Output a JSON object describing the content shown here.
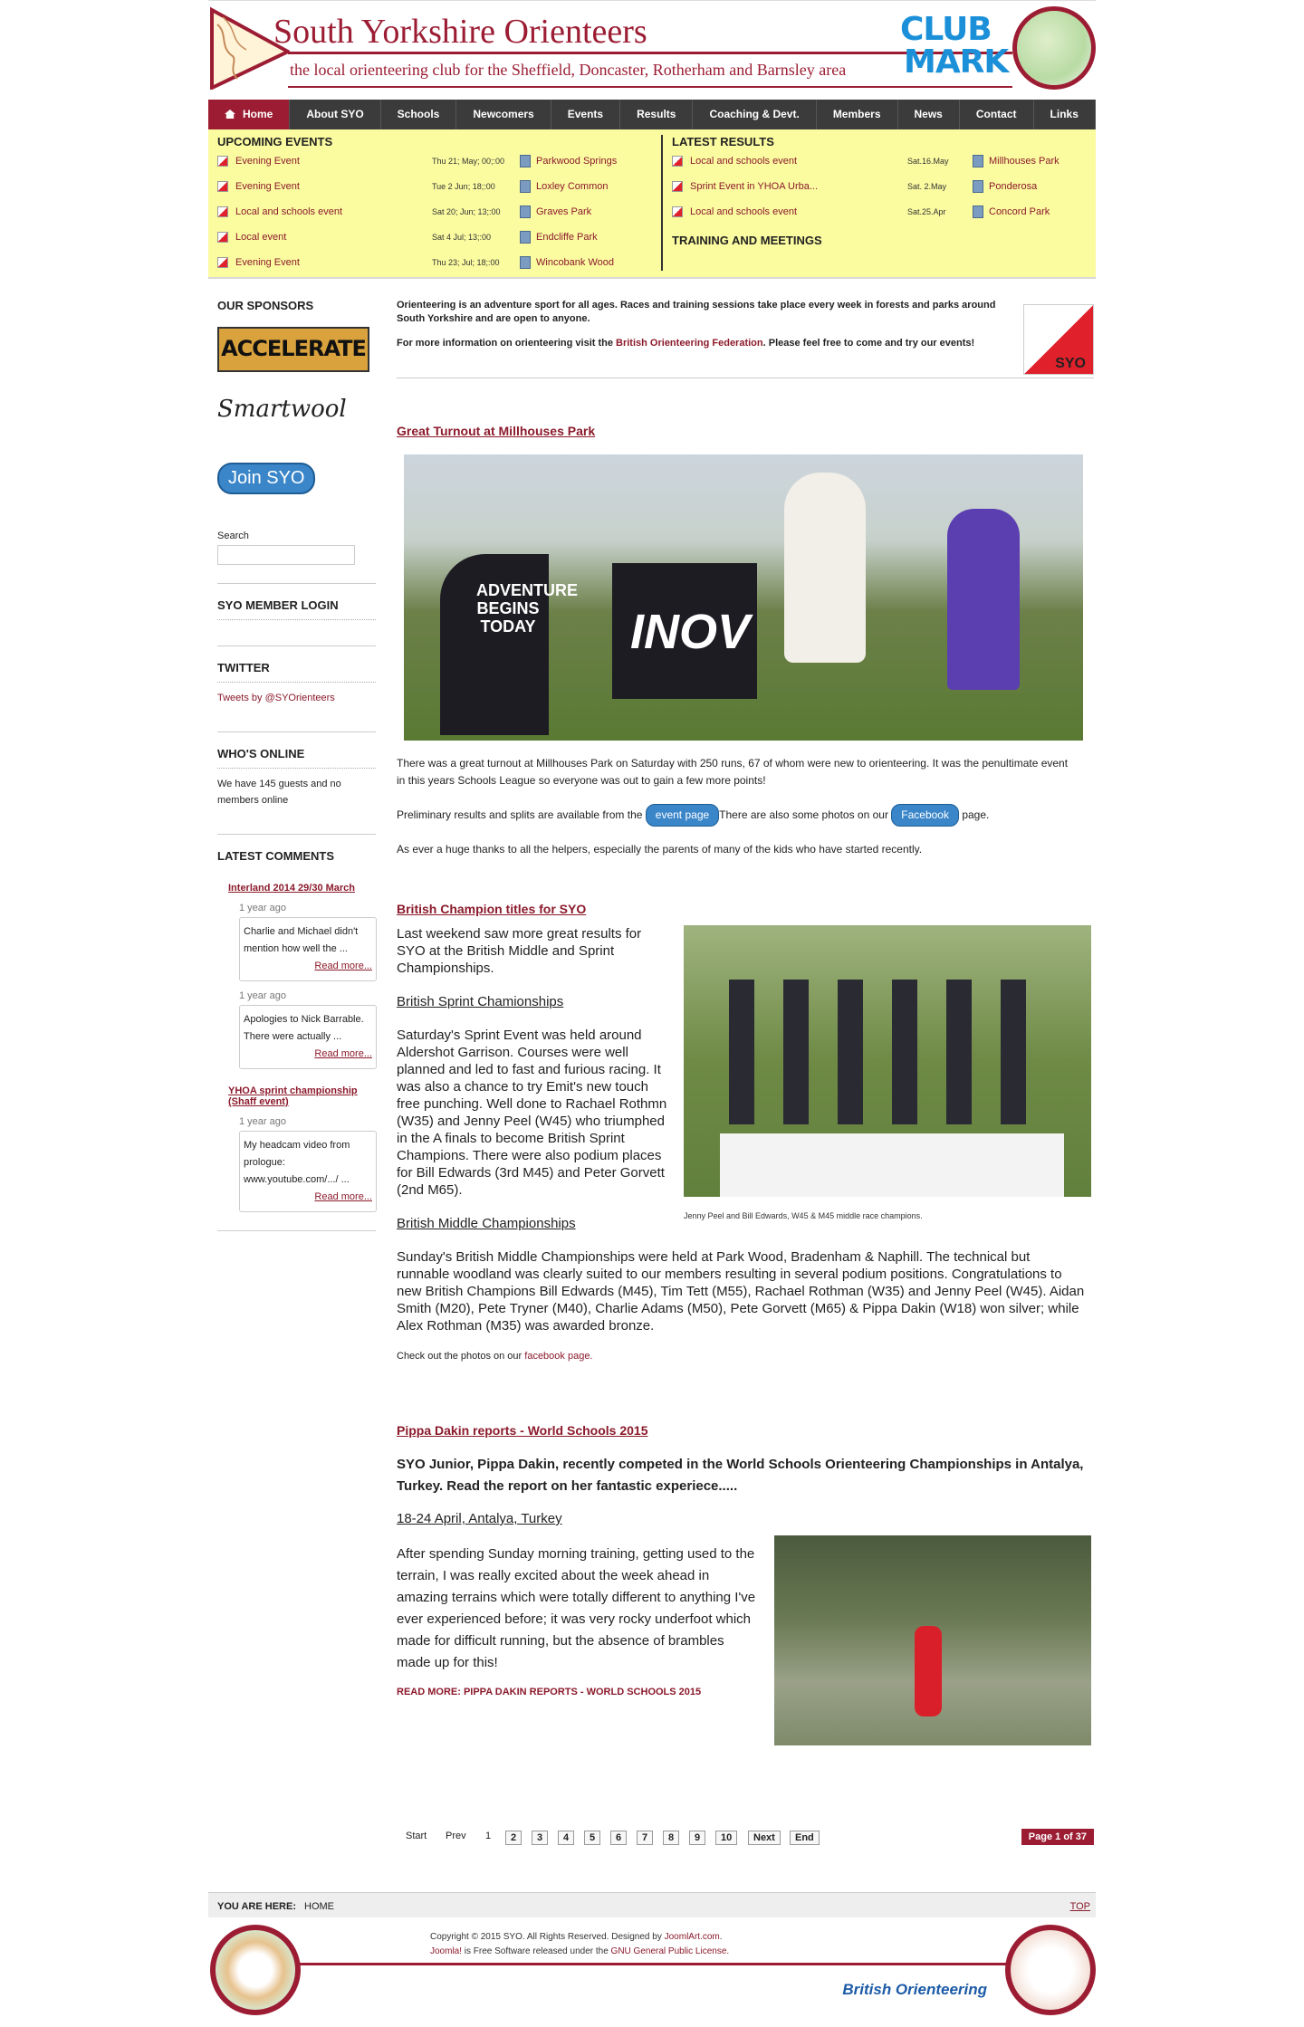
{
  "header": {
    "title": "South Yorkshire Orienteers",
    "tagline": "the local orienteering club for the Sheffield, Doncaster, Rotherham and Barnsley area",
    "clubmark_line1": "CLUB",
    "clubmark_line2": "MARK"
  },
  "nav": {
    "items": [
      "Home",
      "About SYO",
      "Schools",
      "Newcomers",
      "Events",
      "Results",
      "Coaching & Devt.",
      "Members",
      "News",
      "Contact",
      "Links"
    ]
  },
  "upcoming": {
    "title": "UPCOMING EVENTS",
    "rows": [
      {
        "name": "Evening Event",
        "date": "Thu 21; May; 00;:00",
        "loc": "Parkwood Springs"
      },
      {
        "name": "Evening Event",
        "date": "Tue  2 Jun; 18;:00",
        "loc": "Loxley Common"
      },
      {
        "name": "Local and schools event",
        "date": "Sat 20; Jun; 13;:00",
        "loc": "Graves Park"
      },
      {
        "name": "Local event",
        "date": "Sat  4 Jul; 13;:00",
        "loc": "Endcliffe Park"
      },
      {
        "name": "Evening Event",
        "date": "Thu 23; Jul; 18;:00",
        "loc": "Wincobank Wood"
      }
    ]
  },
  "results": {
    "title": "LATEST RESULTS",
    "rows": [
      {
        "name": "Local and schools event",
        "date": "Sat.16.May",
        "loc": "Millhouses Park"
      },
      {
        "name": "Sprint Event in YHOA Urba...",
        "date": "Sat. 2.May",
        "loc": "Ponderosa"
      },
      {
        "name": "Local and schools event",
        "date": "Sat.25.Apr",
        "loc": "Concord Park"
      }
    ],
    "training_title": "TRAINING AND MEETINGS"
  },
  "sidebar": {
    "sponsors_title": "OUR SPONSORS",
    "sponsor1": "ACCELERATE",
    "sponsor2": "Smartwool",
    "join_label": "Join SYO",
    "search_label": "Search",
    "login_title": "SYO MEMBER LOGIN",
    "twitter_title": "TWITTER",
    "twitter_link": "Tweets by @SYOrienteers",
    "online_title": "WHO'S ONLINE",
    "online_text": "We have 145 guests and no members online",
    "comments_title": "LATEST COMMENTS",
    "comments": [
      {
        "title": "Interland 2014 29/30 March",
        "ago1": "1 year ago",
        "text1": "Charlie and Michael didn't mention how well the ...",
        "ago2": "1 year ago",
        "text2": "Apologies to Nick Barrable. There were actually ..."
      },
      {
        "title": "YHOA sprint championship (Shaff event)",
        "ago1": "1 year ago",
        "text1": "My headcam video from prologue: www.youtube.com/.../ ..."
      }
    ],
    "read_more": "Read more..."
  },
  "intro": {
    "p1": "Orienteering is an adventure sport for all ages. Races and training sessions take place every week in forests and parks around South Yorkshire and are open to anyone.",
    "p2_pre": "For more information on orienteering visit the ",
    "p2_link": "British Orienteering Federation",
    "p2_post": ". Please feel free to come and try our events!",
    "badge": "SYO"
  },
  "article1": {
    "title": "Great Turnout at Millhouses Park",
    "p1": "There was a great turnout at Millhouses Park on Saturday with 250 runs, 67 of whom were new to orienteering.  It was the penultimate event in this years Schools League so everyone was out to gain a few more points!",
    "p2_pre": "Preliminary results and splits are available from the ",
    "p2_pill1": "event page",
    "p2_mid": "There are also some photos on our ",
    "p2_pill2": "Facebook",
    "p2_post": " page.",
    "p3": "As ever a huge thanks to all the helpers, especially the parents of many of the kids who have started recently.",
    "banner_text1": "ADVENTURE BEGINS TODAY",
    "banner_text2": "INOV"
  },
  "article2": {
    "title": "British Champion titles for SYO",
    "intro": "Last weekend saw more great results for SYO at the British Middle and Sprint Championships.",
    "h1": "British Sprint Chamionships",
    "sprint": "Saturday's Sprint Event was held around Aldershot Garrison. Courses were well planned and led to fast and furious racing. It was also a chance to try Emit's new touch free punching. Well done to Rachael Rothmn (W35) and Jenny Peel (W45) who triumphed in the A finals to become British Sprint Champions. There were also podium places for Bill Edwards (3rd M45) and Peter Gorvett (2nd M65).",
    "h2": "British Middle Championships",
    "middle": "Sunday's British Middle Championships were held at Park Wood, Bradenham & Naphill. The technical but runnable woodland was clearly suited to our members resulting in several podium positions. Congratulations to new British Champions Bill Edwards (M45), Tim Tett (M55), Rachael Rothman (W35) and Jenny Peel (W45). Aidan Smith (M20), Pete Tryner (M40), Charlie Adams (M50), Pete Gorvett (M65) & Pippa Dakin (W18) won silver; while Alex Rothman (M35) was awarded bronze.",
    "photos_pre": "Check out the photos on our ",
    "photos_link": "facebook page.",
    "caption": "Jenny Peel and Bill Edwards, W45 & M45 middle race champions."
  },
  "article3": {
    "title": "Pippa Dakin reports - World Schools 2015",
    "lead": "SYO Junior, Pippa Dakin, recently competed in the World Schools Orienteering Championships in Antalya, Turkey. Read the report on her fantastic experiece.....",
    "sub": "18-24 April, Antalya, Turkey",
    "body": "After spending Sunday morning training, getting used to the terrain, I was really excited about the week ahead in amazing terrains which were totally different to anything I've ever experienced before; it was very rocky underfoot which made for difficult running, but the absence of brambles made up for this!",
    "readmore": "READ MORE: PIPPA DAKIN REPORTS - WORLD SCHOOLS 2015"
  },
  "pager": {
    "start": "Start",
    "prev": "Prev",
    "current": "1",
    "pages": [
      "2",
      "3",
      "4",
      "5",
      "6",
      "7",
      "8",
      "9",
      "10"
    ],
    "next": "Next",
    "end": "End",
    "page_of": "Page 1 of 37"
  },
  "footer": {
    "you_are_here": "YOU ARE HERE:",
    "home": "HOME",
    "top": "TOP",
    "copy_pre": "Copyright © 2015 SYO. All Rights Reserved. Designed by ",
    "copy_link": "JoomlArt.com",
    "copy_post": ".",
    "joomla": "Joomla!",
    "license_pre": " is Free Software released under the ",
    "license_link": "GNU General Public License.",
    "bo": "British Orienteering"
  },
  "colors": {
    "brand": "#9c1d33",
    "nav": "#3b3b3b",
    "events_bg": "#fbfba0",
    "pill": "#3a86c9"
  }
}
